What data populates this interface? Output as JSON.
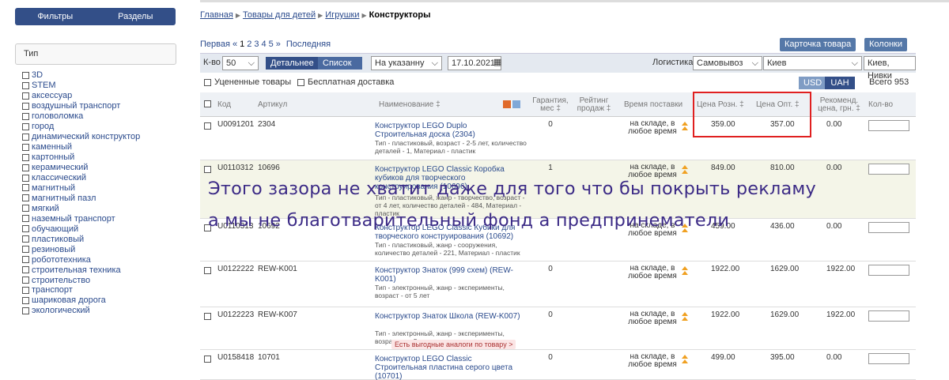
{
  "sidebar": {
    "tabs": [
      "Фильтры",
      "Разделы"
    ],
    "type_label": "Тип",
    "types": [
      "3D",
      "STEM",
      "аксессуар",
      "воздушный транспорт",
      "головоломка",
      "город",
      "динамический конструктор",
      "каменный",
      "картонный",
      "керамический",
      "классический",
      "магнитный",
      "магнитный пазл",
      "мягкий",
      "наземный транспорт",
      "обучающий",
      "пластиковый",
      "резиновый",
      "робототехника",
      "строительная техника",
      "строительство",
      "транспорт",
      "шариковая дорога",
      "экологический"
    ]
  },
  "breadcrumb": {
    "home": "Главная",
    "l2": "Товары для детей",
    "l3": "Игрушки",
    "current": "Конструкторы"
  },
  "pager": {
    "first": "Первая «",
    "pages": [
      "1",
      "2",
      "3",
      "4",
      "5"
    ],
    "next": "»",
    "last": "Последняя"
  },
  "buttons": {
    "card": "Карточка товара",
    "columns": "Колонки"
  },
  "toolbar": {
    "kvo_label": "К-во",
    "kvo_value": "50",
    "view_detailed": "Детальнее",
    "view_list": "Список",
    "date_mode": "На указанну",
    "date": "17.10.2021",
    "logistics_label": "Логистика",
    "logistics": "Самовывоз",
    "city": "Киев",
    "district": "Киев, Нивки",
    "discounted": "Уцененные товары",
    "free_delivery": "Бесплатная доставка",
    "cur_usd": "USD",
    "cur_uah": "UAH",
    "total": "Всего 953"
  },
  "table": {
    "headers": {
      "code": "Код",
      "article": "Артикул",
      "name": "Наименование ‡",
      "warranty": "Гарантия, мес ‡",
      "rating": "Рейтинг продаж ‡",
      "delivery": "Время поставки",
      "retail": "Цена Розн. ‡",
      "wholesale": "Цена Опт. ‡",
      "recommended": "Рекоменд. цена, грн. ‡",
      "qty": "Кол-во"
    },
    "rows": [
      {
        "code": "U0091201",
        "article": "2304",
        "name": "Конструктор LEGO Duplo Строительная доска (2304)",
        "desc": "Тип - пластиковый, возраст - 2-5 лет, количество деталей - 1, Материал - пластик",
        "warranty": "0",
        "delivery": "на складе, в любое время",
        "retail": "359.00",
        "wholesale": "357.00",
        "recommended": "0.00"
      },
      {
        "code": "U0110312",
        "article": "10696",
        "name": "Конструктор LEGO Classic Коробка кубиков для творческого конструирования (10696)",
        "desc": "Тип - пластиковый, жанр - творчество, возраст - от 4 лет, количество деталей - 484, Материал - пластик",
        "warranty": "1",
        "delivery": "на складе, в любое время",
        "retail": "849.00",
        "wholesale": "810.00",
        "recommended": "0.00"
      },
      {
        "code": "U0110313",
        "article": "10692",
        "name": "Конструктор LEGO Classic Кубики для творческого конструирования (10692)",
        "desc": "Тип - пластиковый, жанр - сооружения, количество деталей - 221, Материал - пластик",
        "warranty": "",
        "delivery": "на складе, в любое время",
        "retail": "459.00",
        "wholesale": "436.00",
        "recommended": "0.00"
      },
      {
        "code": "U0122222",
        "article": "REW-K001",
        "name": "Конструктор Знаток (999 схем) (REW-K001)",
        "desc": "Тип - электронный, жанр - эксперименты, возраст - от 5 лет",
        "warranty": "0",
        "delivery": "на складе, в любое время",
        "retail": "1922.00",
        "wholesale": "1629.00",
        "recommended": "1922.00"
      },
      {
        "code": "U0122223",
        "article": "REW-K007",
        "name": "Конструктор Знаток Школа (REW-K007)",
        "desc": "Тип - электронный, жанр - эксперименты, возраст - от 5 лет",
        "warranty": "0",
        "delivery": "на складе, в любое время",
        "retail": "1922.00",
        "wholesale": "1629.00",
        "recommended": "1922.00",
        "analog": "Есть выгодные аналоги по товару >"
      },
      {
        "code": "U0158418",
        "article": "10701",
        "name": "Конструктор LEGO Classic Строительная пластина серого цвета (10701)",
        "desc": "",
        "warranty": "0",
        "delivery": "на складе, в любое время",
        "retail": "499.00",
        "wholesale": "395.00",
        "recommended": "0.00"
      }
    ]
  },
  "overlay": {
    "line1": "Этого зазора не хватит даже для того что бы покрыть рекламу",
    "line2": "а мы не благотварительный фонд а предпринематели"
  },
  "colors": {
    "accent": "#334f88",
    "highlight": "#e02020",
    "overlay_text": "#3c2b86"
  }
}
